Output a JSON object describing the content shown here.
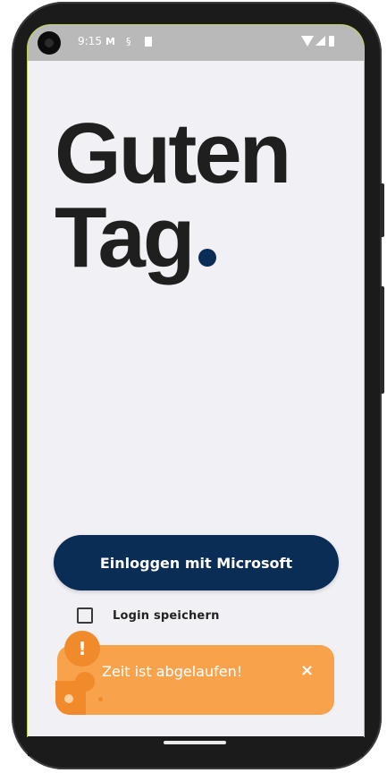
{
  "status_bar": {
    "time": "9:15",
    "icons": [
      "gmail-icon",
      "sync-icon",
      "sd-card-icon",
      "wifi-icon",
      "signal-icon",
      "battery-icon"
    ]
  },
  "greeting": {
    "line1": "Guten",
    "line2": "Tag",
    "accent_color": "#0a2d55"
  },
  "login": {
    "button_label": "Einloggen mit Microsoft",
    "remember_label": "Login speichern",
    "remember_checked": false
  },
  "toast": {
    "message": "Zeit ist abgelaufen!",
    "badge": "!",
    "close": "×",
    "color": "#f8a24b"
  }
}
